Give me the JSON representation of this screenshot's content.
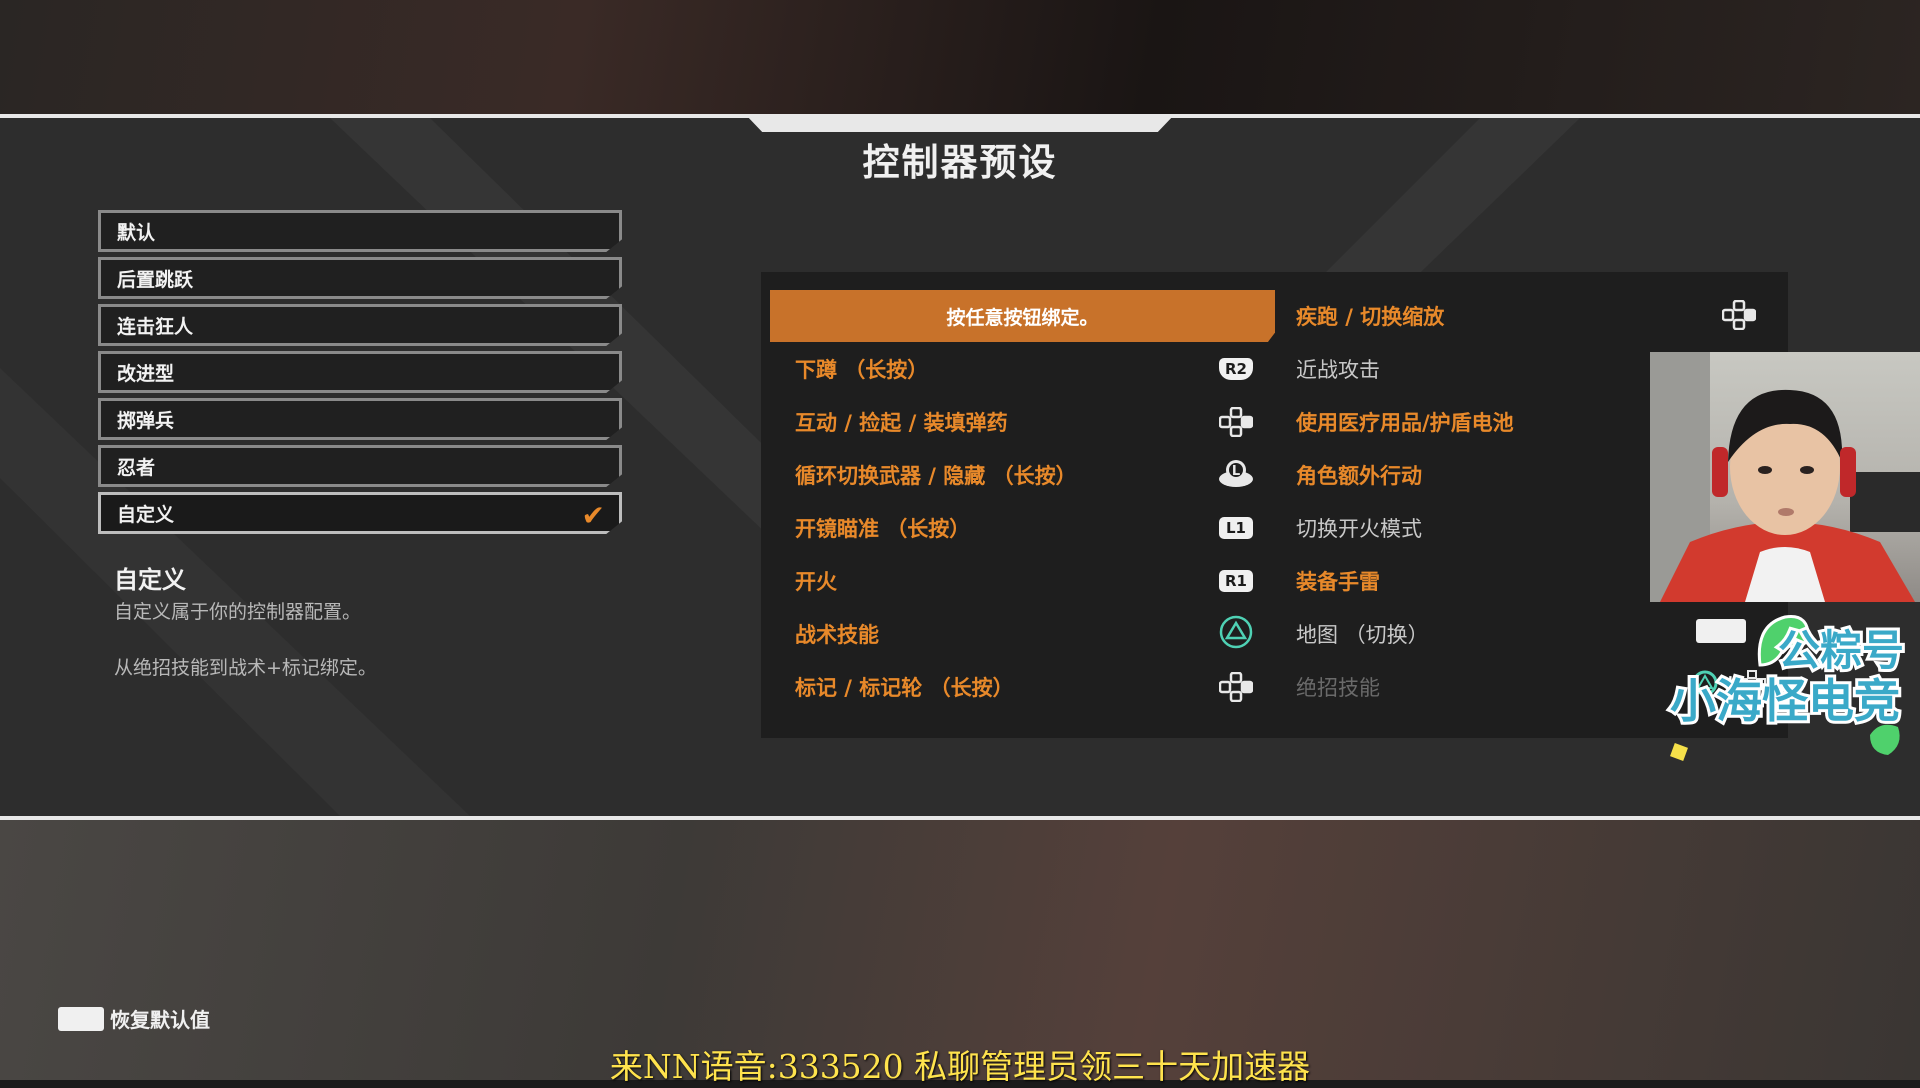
{
  "page_title": "控制器预设",
  "presets": [
    {
      "label": "默认",
      "selected": false
    },
    {
      "label": "后置跳跃",
      "selected": false
    },
    {
      "label": "连击狂人",
      "selected": false
    },
    {
      "label": "改进型",
      "selected": false
    },
    {
      "label": "掷弹兵",
      "selected": false
    },
    {
      "label": "忍者",
      "selected": false
    },
    {
      "label": "自定义",
      "selected": true
    }
  ],
  "selected_check_icon": "checkmark-icon",
  "description": {
    "title": "自定义",
    "line1": "自定义属于你的控制器配置。",
    "line2": "从绝招技能到战术+标记绑定。"
  },
  "bindings": {
    "prompt": "按任意按钮绑定。",
    "left": [
      {
        "label": "下蹲 （长按）",
        "button": "R2",
        "icon": "r2-button-icon"
      },
      {
        "label": "互动 / 捡起 / 装填弹药",
        "button": "",
        "icon": "dpad-icon"
      },
      {
        "label": "循环切换武器 / 隐藏 （长按）",
        "button": "L",
        "icon": "left-stick-icon"
      },
      {
        "label": "开镜瞄准 （长按）",
        "button": "L1",
        "icon": "l1-button-icon"
      },
      {
        "label": "开火",
        "button": "R1",
        "icon": "r1-button-icon"
      },
      {
        "label": "战术技能",
        "button": "",
        "icon": "triangle-button-icon"
      },
      {
        "label": "标记 / 标记轮 （长按）",
        "button": "",
        "icon": "dpad-icon"
      }
    ],
    "right": [
      {
        "label": "疾跑 / 切换缩放",
        "style": "orange",
        "icon": "dpad-icon"
      },
      {
        "label": "近战攻击",
        "style": "gray"
      },
      {
        "label": "使用医疗用品/护盾电池",
        "style": "orange"
      },
      {
        "label": "角色额外行动",
        "style": "orange"
      },
      {
        "label": "切换开火模式",
        "style": "gray"
      },
      {
        "label": "装备手雷",
        "style": "orange"
      },
      {
        "label": "地图 （切换）",
        "style": "gray"
      },
      {
        "label": "绝招技能",
        "style": "dim"
      }
    ]
  },
  "overlay": {
    "logo_line1": "公粽号",
    "logo_line2": "小海怪电竞"
  },
  "footer": {
    "restore_label": "恢复默认值",
    "restore_icon": "touchpad-icon"
  },
  "ad_banner": "来NN语音:333520 私聊管理员领三十天加速器",
  "colors": {
    "accent": "#c8722a",
    "accent_text": "#e8892a",
    "panel": "#2d2d2d",
    "ad_text": "#ffe34d"
  }
}
